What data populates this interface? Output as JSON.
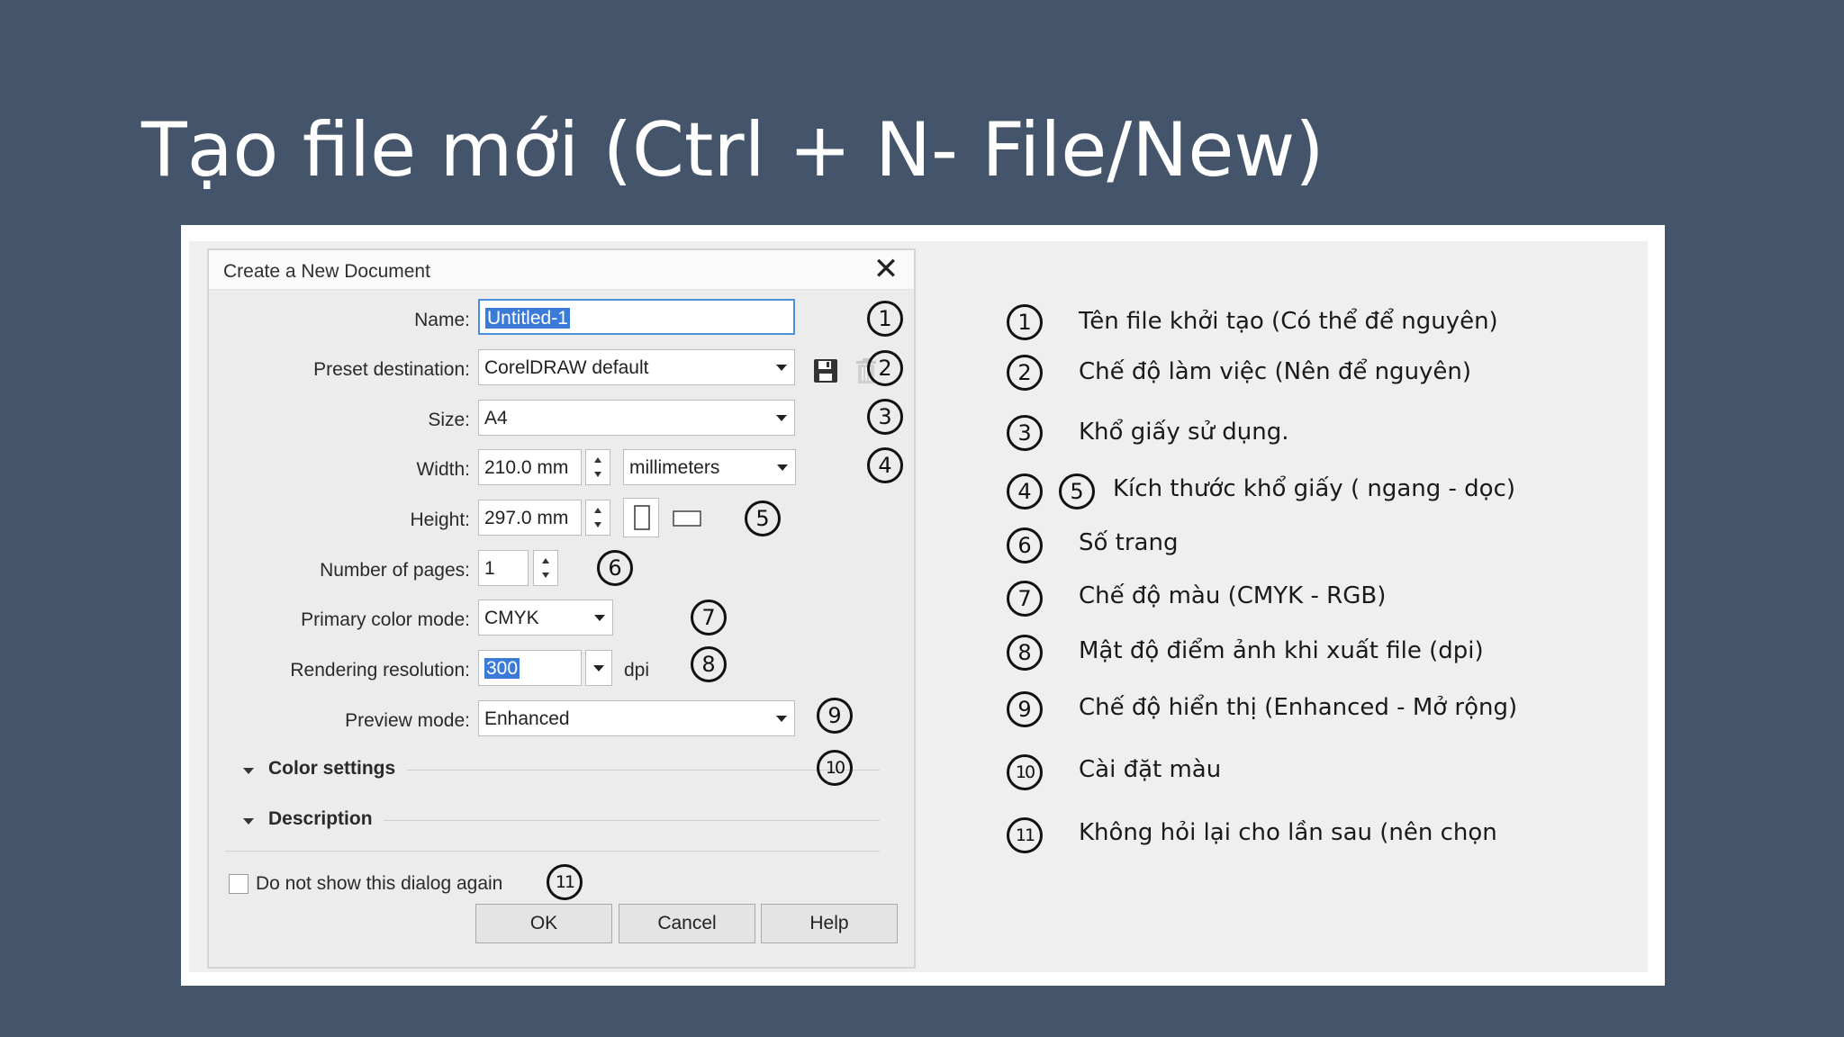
{
  "slide": {
    "title": "Tạo file mới (Ctrl + N- File/New)"
  },
  "dialog": {
    "title": "Create a New Document",
    "close_glyph": "✕",
    "fields": {
      "name": {
        "label": "Name:",
        "value": "Untitled-1"
      },
      "preset": {
        "label": "Preset destination:",
        "value": "CorelDRAW default"
      },
      "size": {
        "label": "Size:",
        "value": "A4"
      },
      "width": {
        "label": "Width:",
        "value": "210.0 mm",
        "unit": "millimeters"
      },
      "height": {
        "label": "Height:",
        "value": "297.0 mm"
      },
      "pages": {
        "label": "Number of pages:",
        "value": "1"
      },
      "color_mode": {
        "label": "Primary color mode:",
        "value": "CMYK"
      },
      "resolution": {
        "label": "Rendering resolution:",
        "value": "300",
        "unit": "dpi"
      },
      "preview": {
        "label": "Preview mode:",
        "value": "Enhanced"
      }
    },
    "sections": {
      "color_settings": "Color settings",
      "description": "Description"
    },
    "checkbox": {
      "label": "Do not show this dialog again",
      "checked": false
    },
    "buttons": {
      "ok": "OK",
      "cancel": "Cancel",
      "help": "Help"
    },
    "markers": [
      "1",
      "2",
      "3",
      "4",
      "5",
      "6",
      "7",
      "8",
      "9",
      "10",
      "11"
    ]
  },
  "legend": [
    {
      "nums": [
        "1"
      ],
      "text": "Tên file khởi tạo (Có thể để nguyên)"
    },
    {
      "nums": [
        "2"
      ],
      "text": "Chế độ làm việc (Nên để nguyên)"
    },
    {
      "nums": [
        "3"
      ],
      "text": "Khổ giấy sử dụng."
    },
    {
      "nums": [
        "4",
        "5"
      ],
      "text": "Kích thước khổ giấy ( ngang - dọc)"
    },
    {
      "nums": [
        "6"
      ],
      "text": "Số trang"
    },
    {
      "nums": [
        "7"
      ],
      "text": "Chế độ màu (CMYK - RGB)"
    },
    {
      "nums": [
        "8"
      ],
      "text": "Mật độ điểm ảnh khi xuất file (dpi)"
    },
    {
      "nums": [
        "9"
      ],
      "text": "Chế độ hiển thị (Enhanced - Mở rộng)"
    },
    {
      "nums": [
        "10"
      ],
      "text": "Cài đặt màu"
    },
    {
      "nums": [
        "11"
      ],
      "text": "Không hỏi lại cho lần sau (nên chọn"
    }
  ],
  "colors": {
    "slide_bg": "#44546a",
    "selection": "#3a7ad8",
    "focus_border": "#4a90d9"
  }
}
